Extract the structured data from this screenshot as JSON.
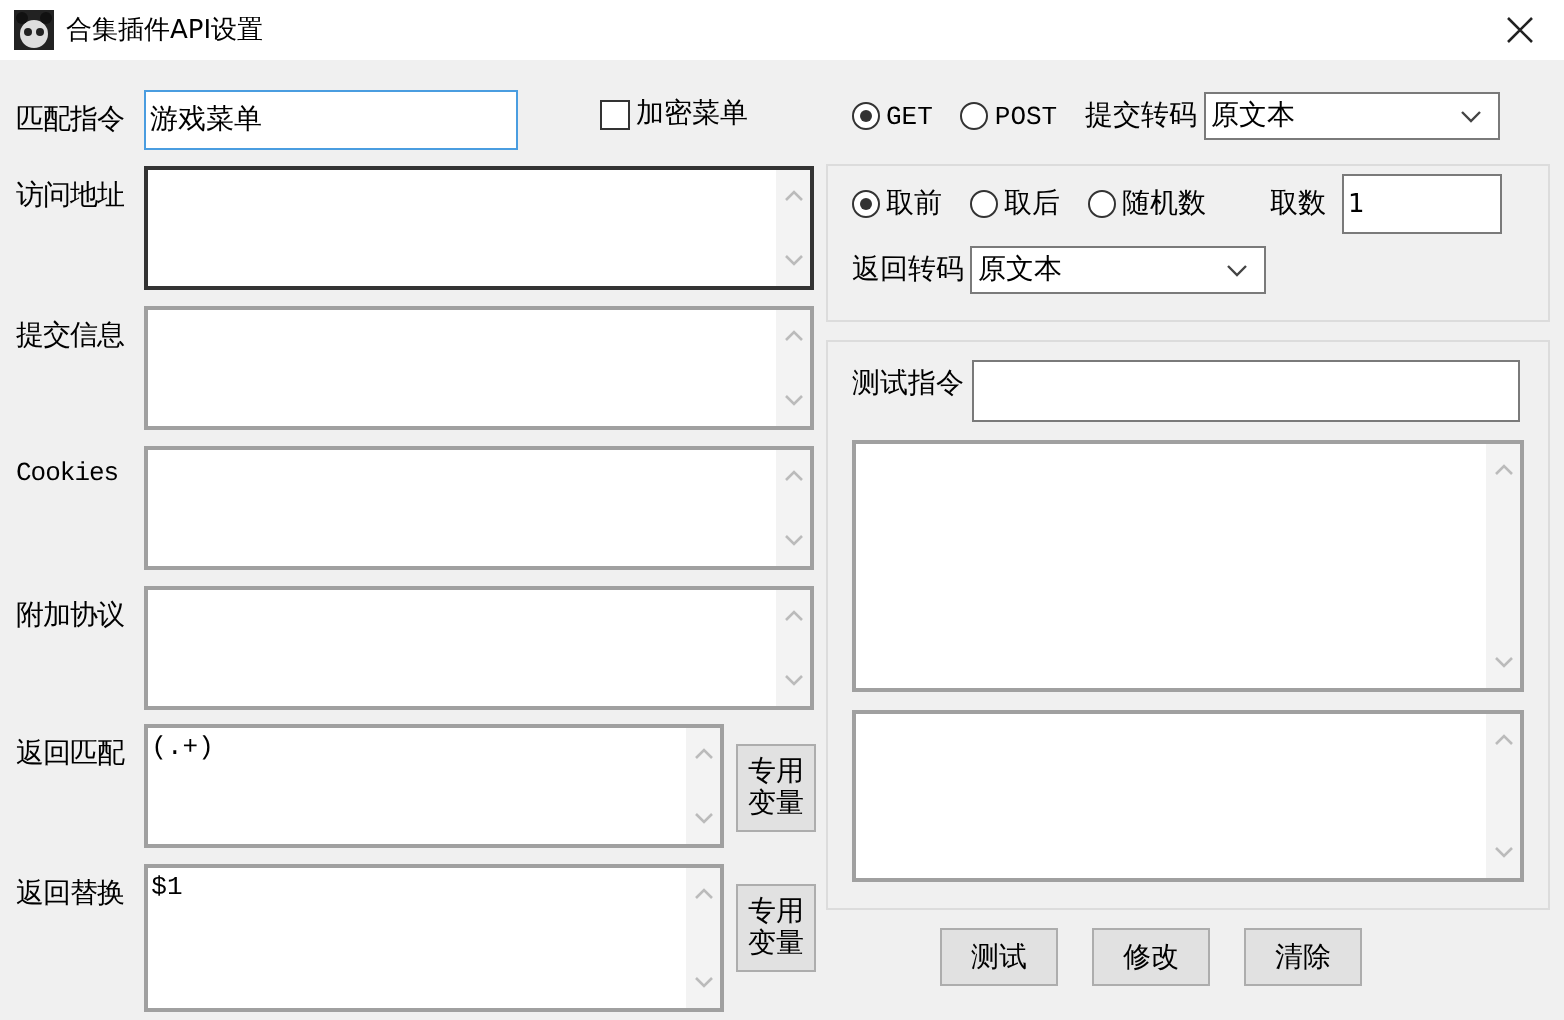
{
  "window": {
    "title": "合集插件API设置"
  },
  "match_command": {
    "label": "匹配指令",
    "value": "游戏菜单"
  },
  "encrypt_menu": {
    "label": "加密菜单",
    "checked": false
  },
  "request_fields": [
    {
      "label": "访问地址"
    },
    {
      "label": "提交信息"
    },
    {
      "label": "Cookies"
    },
    {
      "label": "附加协议"
    }
  ],
  "return_fields": [
    {
      "label": "返回匹配",
      "value": "(.+)",
      "button": "专用变量"
    },
    {
      "label": "返回替换",
      "value": "$1",
      "button": "专用变量"
    }
  ],
  "method_options": [
    {
      "label": "GET",
      "selected": true
    },
    {
      "label": "POST",
      "selected": false
    }
  ],
  "submit_encoding": {
    "label": "提交转码",
    "value": "原文本"
  },
  "take_options": [
    {
      "label": "取前",
      "selected": true
    },
    {
      "label": "取后",
      "selected": false
    },
    {
      "label": "随机数",
      "selected": false
    }
  ],
  "take_count": {
    "label": "取数",
    "value": "1"
  },
  "return_encoding": {
    "label": "返回转码",
    "value": "原文本"
  },
  "test_command": {
    "label": "测试指令"
  },
  "buttons": [
    "测试",
    "修改",
    "清除"
  ]
}
